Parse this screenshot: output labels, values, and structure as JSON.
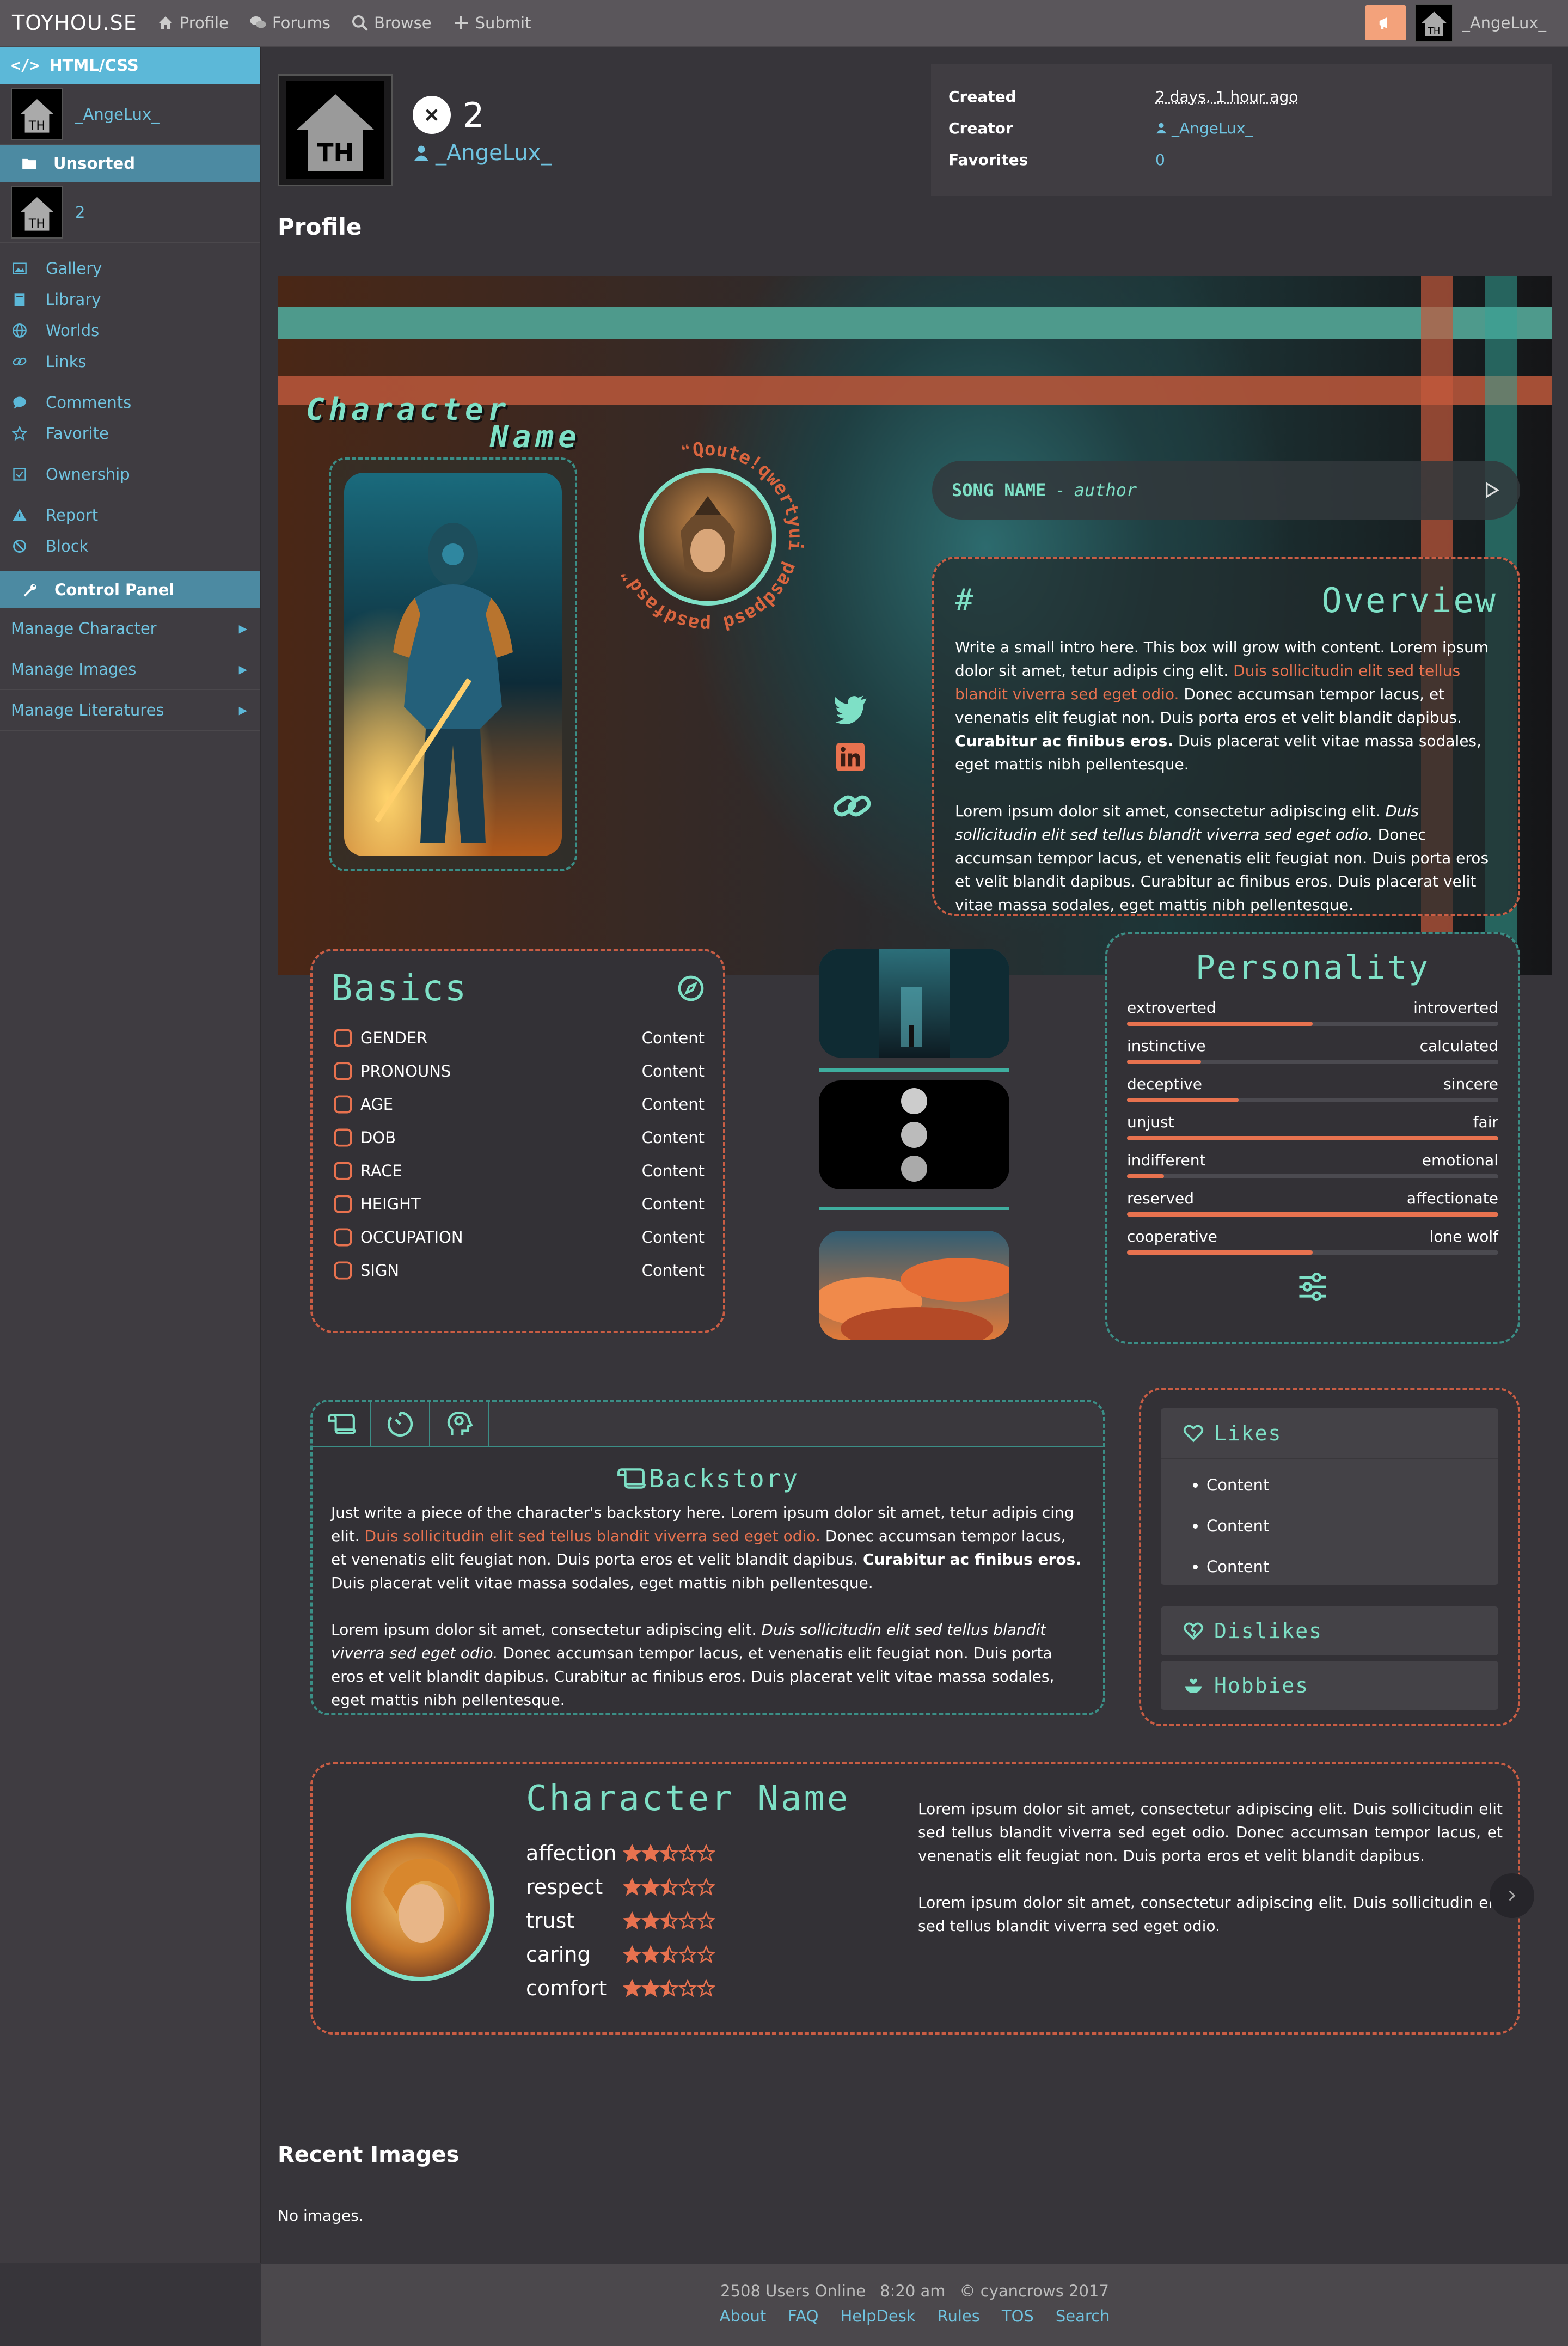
{
  "topbar": {
    "logo": "TOYHOU.SE",
    "nav": [
      {
        "label": "Profile"
      },
      {
        "label": "Forums"
      },
      {
        "label": "Browse"
      },
      {
        "label": "Submit"
      }
    ],
    "username": "_AngeLux_"
  },
  "sidebar": {
    "head": "HTML/CSS",
    "user": "_AngeLux_",
    "section": "Unsorted",
    "character": "2",
    "links": [
      {
        "label": "Gallery"
      },
      {
        "label": "Library"
      },
      {
        "label": "Worlds"
      },
      {
        "label": "Links"
      },
      {
        "label": "Comments"
      },
      {
        "label": "Favorite"
      },
      {
        "label": "Ownership"
      },
      {
        "label": "Report"
      },
      {
        "label": "Block"
      }
    ],
    "control_panel": "Control Panel",
    "manage": [
      {
        "label": "Manage Character"
      },
      {
        "label": "Manage Images"
      },
      {
        "label": "Manage Literatures"
      }
    ]
  },
  "character": {
    "name": "2",
    "owner": "_AngeLux_",
    "avatar_text": "TH"
  },
  "info": {
    "created_label": "Created",
    "created_value": "2 days, 1 hour ago",
    "creator_label": "Creator",
    "creator_value": "_AngeLux_",
    "favorites_label": "Favorites",
    "favorites_value": "0"
  },
  "profile_heading": "Profile",
  "canvas": {
    "title_line1": "Character",
    "title_line2": "Name",
    "quote": "❝Qoute!qwertyui pasdpasd pasdfasd❞",
    "song": "SONG NAME",
    "song_author": "author",
    "song_dash": "-",
    "overview": {
      "hash": "#",
      "title": "Overview",
      "p1a": "Write a small intro here. This box will grow with content. Lorem ipsum dolor sit amet, tetur adipis cing elit. ",
      "p1b": "Duis sollicitudin elit sed tellus blandit viverra sed eget odio.",
      "p1c": " Donec accumsan tempor lacus, et venenatis elit feugiat non. Duis porta eros et velit blandit dapibus. ",
      "p1d": "Curabitur ac finibus eros.",
      "p1e": " Duis placerat velit vitae massa sodales, eget mattis nibh pellentesque.",
      "p2a": "Lorem ipsum dolor sit amet, consectetur adipiscing elit. ",
      "p2b": "Duis sollicitudin elit sed tellus blandit viverra sed eget odio.",
      "p2c": " Donec accumsan tempor lacus, et venenatis elit feugiat non. Duis porta eros et velit blandit dapibus. Curabitur ac finibus eros. Duis placerat velit vitae massa sodales, eget mattis nibh pellentesque."
    }
  },
  "basics": {
    "title": "Basics",
    "rows": [
      {
        "label": "GENDER",
        "value": "Content"
      },
      {
        "label": "PRONOUNS",
        "value": "Content"
      },
      {
        "label": "AGE",
        "value": "Content"
      },
      {
        "label": "DOB",
        "value": "Content"
      },
      {
        "label": "RACE",
        "value": "Content"
      },
      {
        "label": "HEIGHT",
        "value": "Content"
      },
      {
        "label": "OCCUPATION",
        "value": "Content"
      },
      {
        "label": "SIGN",
        "value": "Content"
      }
    ]
  },
  "personality": {
    "title": "Personality",
    "rows": [
      {
        "left": "extroverted",
        "right": "introverted",
        "level": 0.5
      },
      {
        "left": "instinctive",
        "right": "calculated",
        "level": 0.2
      },
      {
        "left": "deceptive",
        "right": "sincere",
        "level": 0.3
      },
      {
        "left": "unjust",
        "right": "fair",
        "level": 1.0
      },
      {
        "left": "indifferent",
        "right": "emotional",
        "level": 0.1
      },
      {
        "left": "reserved",
        "right": "affectionate",
        "level": 1.0
      },
      {
        "left": "cooperative",
        "right": "lone wolf",
        "level": 0.5
      }
    ]
  },
  "backstory": {
    "title": "Backstory",
    "p1a": "Just write a piece of the character's backstory here. Lorem ipsum dolor sit amet, tetur adipis cing elit. ",
    "p1b": "Duis sollicitudin elit sed tellus blandit viverra sed eget odio.",
    "p1c": " Donec accumsan tempor lacus, et venenatis elit feugiat non. Duis porta eros et velit blandit dapibus. ",
    "p1d": "Curabitur ac finibus eros.",
    "p1e": " Duis placerat velit vitae massa sodales, eget mattis nibh pellentesque.",
    "p2a": "Lorem ipsum dolor sit amet, consectetur adipiscing elit. ",
    "p2b": "Duis sollicitudin elit sed tellus blandit viverra sed eget odio.",
    "p2c": " Donec accumsan tempor lacus, et venenatis elit feugiat non. Duis porta eros et velit blandit dapibus. Curabitur ac finibus eros. Duis placerat velit vitae massa sodales, eget mattis nibh pellentesque."
  },
  "likes": {
    "title": "Likes",
    "items": [
      "Content",
      "Content",
      "Content"
    ],
    "dislikes": "Dislikes",
    "hobbies": "Hobbies"
  },
  "relation": {
    "title": "Character Name",
    "stats": [
      {
        "label": "affection",
        "stars": 2.5
      },
      {
        "label": "respect",
        "stars": 2.5
      },
      {
        "label": "trust",
        "stars": 2.5
      },
      {
        "label": "caring",
        "stars": 2.5
      },
      {
        "label": "comfort",
        "stars": 2.5
      }
    ],
    "p1": "Lorem ipsum dolor sit amet, consectetur adipiscing elit. Duis sollicitudin elit sed tellus blandit viverra sed eget odio. Donec accumsan tempor lacus, et venenatis elit feugiat non. Duis porta eros et velit blandit dapibus.",
    "p2": "Lorem ipsum dolor sit amet, consectetur adipiscing elit. Duis sollicitudin elit sed tellus blandit viverra sed eget odio."
  },
  "recent_images": {
    "title": "Recent Images",
    "empty": "No images."
  },
  "footer": {
    "users": "2508 Users Online",
    "time": "8:20 am",
    "copyright": "© cyancrows 2017",
    "links": [
      {
        "label": "About"
      },
      {
        "label": "FAQ"
      },
      {
        "label": "HelpDesk"
      },
      {
        "label": "Rules"
      },
      {
        "label": "TOS"
      },
      {
        "label": "Search"
      }
    ]
  },
  "colors": {
    "accent_teal": "#7ee0c6",
    "accent_orange": "#e8724f",
    "link_blue": "#6fc3e0"
  }
}
